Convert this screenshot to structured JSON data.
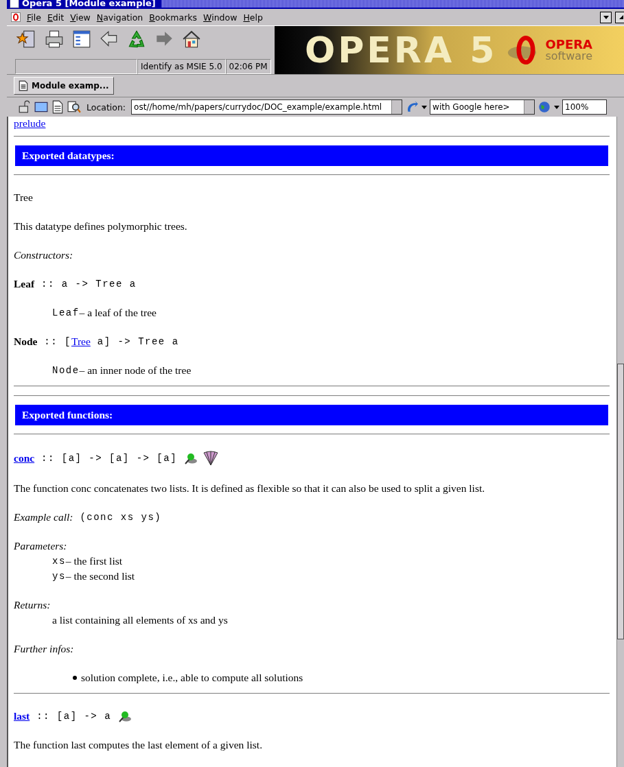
{
  "window": {
    "title": "Opera 5 [Module example]"
  },
  "menu": [
    {
      "label": "File"
    },
    {
      "label": "Edit"
    },
    {
      "label": "View"
    },
    {
      "label": "Navigation"
    },
    {
      "label": "Bookmarks"
    },
    {
      "label": "Window"
    },
    {
      "label": "Help"
    }
  ],
  "status": {
    "identify": "Identify as MSIE 5.0",
    "time": "02:06 PM"
  },
  "banner": {
    "title": "OPERA 5",
    "brand": "OPERA",
    "sub": "software"
  },
  "tabs": [
    {
      "label": "Module examp...",
      "selected": true
    }
  ],
  "address": {
    "label": "Location:",
    "url": "ost//home/mh/papers/currydoc/DOC_example/example.html",
    "search": "with Google here>",
    "zoom": "100%"
  },
  "content": [
    {
      "kind": "top-link",
      "segments": [
        {
          "kind": "link",
          "text": "prelude"
        }
      ]
    },
    {
      "kind": "rule"
    },
    {
      "kind": "header",
      "text": "Exported datatypes:"
    },
    {
      "kind": "rule"
    },
    {
      "kind": "para",
      "segments": [
        {
          "kind": "plain",
          "text": "Tree"
        }
      ]
    },
    {
      "kind": "para",
      "segments": [
        {
          "kind": "plain",
          "text": "This datatype defines polymorphic trees."
        }
      ]
    },
    {
      "kind": "para",
      "segments": [
        {
          "kind": "italic",
          "text": "Constructors:"
        }
      ]
    },
    {
      "kind": "para",
      "segments": [
        {
          "kind": "bold",
          "text": "Leaf"
        },
        {
          "kind": "code",
          "text": " :: a -> Tree a"
        }
      ]
    },
    {
      "kind": "indented",
      "segments": [
        {
          "kind": "code",
          "text": "Leaf"
        },
        {
          "kind": "plain",
          "text": " – a leaf of the tree"
        }
      ]
    },
    {
      "kind": "para",
      "segments": [
        {
          "kind": "bold",
          "text": "Node"
        },
        {
          "kind": "code",
          "text": " :: ["
        },
        {
          "kind": "link",
          "text": "Tree"
        },
        {
          "kind": "code",
          "text": " a] -> Tree a"
        }
      ]
    },
    {
      "kind": "indented",
      "segments": [
        {
          "kind": "code",
          "text": "Node"
        },
        {
          "kind": "plain",
          "text": " – an inner node of the tree"
        }
      ]
    },
    {
      "kind": "rule"
    },
    {
      "kind": "rule"
    },
    {
      "kind": "header",
      "text": "Exported functions:"
    },
    {
      "kind": "rule"
    },
    {
      "kind": "para",
      "segments": [
        {
          "kind": "link-bold",
          "text": "conc"
        },
        {
          "kind": "code",
          "text": " :: [a] -> [a] -> [a]"
        },
        {
          "kind": "pin-icon"
        },
        {
          "kind": "fan-icon"
        }
      ]
    },
    {
      "kind": "para",
      "segments": [
        {
          "kind": "plain",
          "text": "The function conc concatenates two lists. It is defined as flexible so that it can also be used to split a given list."
        }
      ]
    },
    {
      "kind": "para",
      "segments": [
        {
          "kind": "italic",
          "text": "Example call:"
        },
        {
          "kind": "code",
          "text": " (conc xs ys)"
        }
      ]
    },
    {
      "kind": "label",
      "segments": [
        {
          "kind": "italic",
          "text": "Parameters:"
        }
      ]
    },
    {
      "kind": "sub",
      "segments": [
        {
          "kind": "code",
          "text": "xs"
        },
        {
          "kind": "plain",
          "text": " – the first list"
        }
      ]
    },
    {
      "kind": "sub-last",
      "segments": [
        {
          "kind": "code",
          "text": "ys"
        },
        {
          "kind": "plain",
          "text": " – the second list"
        }
      ]
    },
    {
      "kind": "label",
      "segments": [
        {
          "kind": "italic",
          "text": "Returns:"
        }
      ]
    },
    {
      "kind": "sub-last",
      "segments": [
        {
          "kind": "plain",
          "text": "a list containing all elements of xs and ys"
        }
      ]
    },
    {
      "kind": "para",
      "segments": [
        {
          "kind": "italic",
          "text": "Further infos:"
        }
      ]
    },
    {
      "kind": "bullet",
      "segments": [
        {
          "kind": "plain",
          "text": "solution complete, i.e., able to compute all solutions"
        }
      ]
    },
    {
      "kind": "rule"
    },
    {
      "kind": "para",
      "segments": [
        {
          "kind": "link-bold",
          "text": "last"
        },
        {
          "kind": "code",
          "text": " :: [a] -> a"
        },
        {
          "kind": "pin-icon"
        }
      ]
    },
    {
      "kind": "para",
      "segments": [
        {
          "kind": "plain",
          "text": "The function last computes the last element of a given list."
        }
      ]
    }
  ]
}
